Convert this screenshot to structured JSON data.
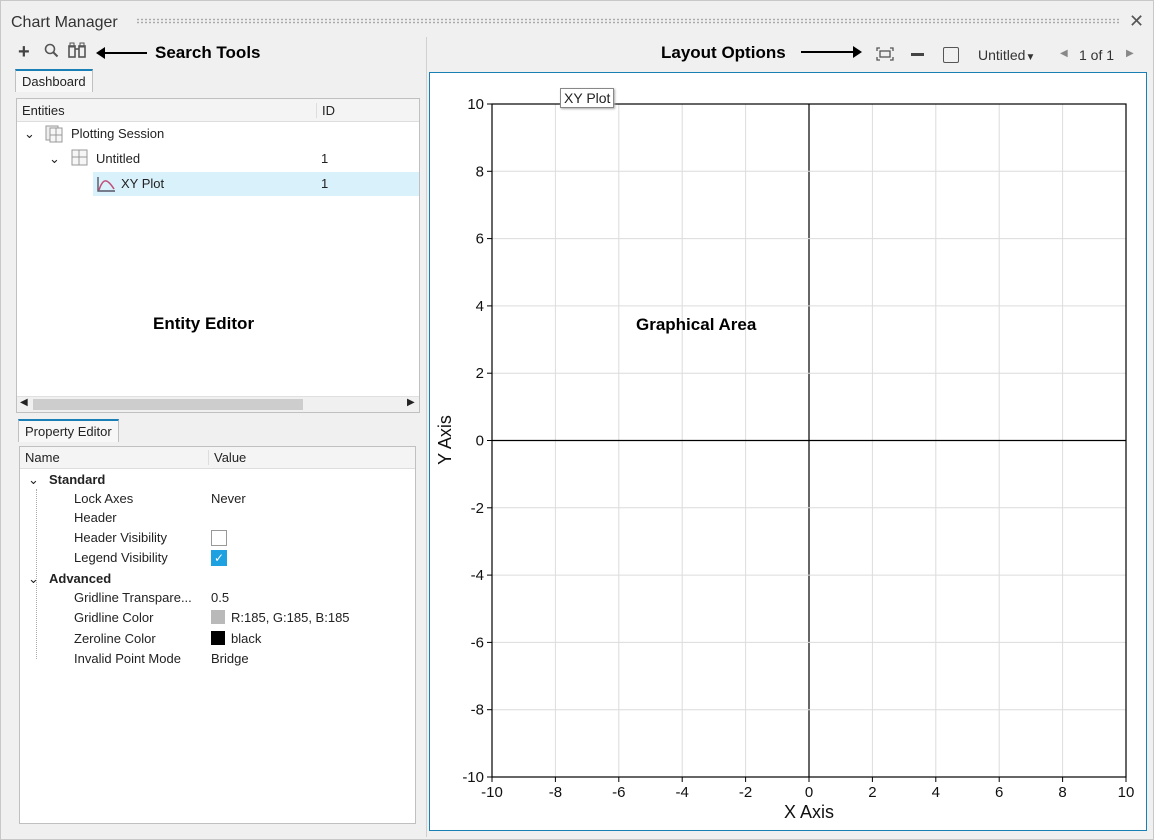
{
  "window": {
    "title": "Chart Manager",
    "close_icon": "close-icon"
  },
  "annotations": {
    "search_tools": "Search Tools",
    "layout_options": "Layout Options",
    "entity_editor": "Entity Editor",
    "graphical_area": "Graphical Area"
  },
  "entity_tab": "Dashboard",
  "entity_tree": {
    "columns": [
      "Entities",
      "ID"
    ],
    "rows": [
      {
        "label": "Plotting Session",
        "id": ""
      },
      {
        "label": "Untitled",
        "id": "1"
      },
      {
        "label": "XY Plot",
        "id": "1",
        "selected": true
      }
    ]
  },
  "property_tab": "Property Editor",
  "properties": {
    "columns": [
      "Name",
      "Value"
    ],
    "groups": [
      {
        "name": "Standard",
        "items": [
          {
            "name": "Lock Axes",
            "value": "Never"
          },
          {
            "name": "Header",
            "value": ""
          },
          {
            "name": "Header Visibility",
            "checked": false
          },
          {
            "name": "Legend Visibility",
            "checked": true
          }
        ]
      },
      {
        "name": "Advanced",
        "items": [
          {
            "name": "Gridline Transpare...",
            "value": "0.5"
          },
          {
            "name": "Gridline Color",
            "value": "R:185, G:185, B:185",
            "swatch": "#b9b9b9"
          },
          {
            "name": "Zeroline Color",
            "value": "black",
            "swatch": "#000000"
          },
          {
            "name": "Invalid Point Mode",
            "value": "Bridge"
          }
        ]
      }
    ]
  },
  "layout_toolbar": {
    "page_select": "Untitled",
    "page_indicator": "1 of 1"
  },
  "chart_data": {
    "type": "line",
    "title": "XY Plot",
    "xlabel": "X Axis",
    "ylabel": "Y Axis",
    "xlim": [
      -10,
      10
    ],
    "ylim": [
      -10,
      10
    ],
    "xticks": [
      -10,
      -8,
      -6,
      -4,
      -2,
      0,
      2,
      4,
      6,
      8,
      10
    ],
    "yticks": [
      10,
      8,
      6,
      4,
      2,
      0,
      -2,
      -4,
      -6,
      -8,
      -10
    ],
    "grid": true,
    "series": []
  },
  "colors": {
    "accent": "#1a7fb5",
    "selection": "#d9f1fb",
    "checkbox": "#1ea1e0"
  }
}
